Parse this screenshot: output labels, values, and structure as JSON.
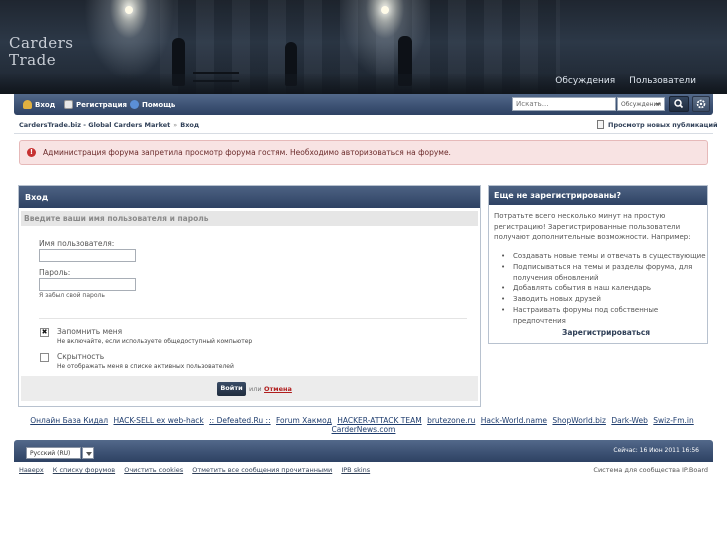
{
  "header": {
    "logo_line1": "Carders",
    "logo_line2": "Trade",
    "nav": [
      "Обсуждения",
      "Пользователи"
    ]
  },
  "toolbar": {
    "login": "Вход",
    "register": "Регистрация",
    "help": "Помощь",
    "search_placeholder": "Искать...",
    "search_scope": "Обсуждения"
  },
  "breadcrumb": {
    "site": "CardersTrade.biz - Global Carders Market",
    "current": "Вход",
    "new_posts": "Просмотр новых публикаций"
  },
  "error": {
    "icon": "!",
    "text": "Администрация форума запретила просмотр форума гостям. Необходимо авторизоваться на форуме."
  },
  "login": {
    "title": "Вход",
    "subtitle": "Введите ваши имя пользователя и пароль",
    "username_label": "Имя пользователя:",
    "password_label": "Пароль:",
    "forgot": "Я забыл свой пароль",
    "remember_label": "Запомнить меня",
    "remember_desc": "Не включайте, если используете общедоступный компьютер",
    "remember_mark": "✖",
    "hidden_label": "Скрытность",
    "hidden_desc": "Не отображать меня в списке активных пользователей",
    "submit": "Войти",
    "or": "или",
    "cancel": "Отмена"
  },
  "register": {
    "title": "Еще не зарегистрированы?",
    "intro": "Потратьте всего несколько минут на простую регистрацию! Зарегистрированные пользователи получают дополнительные возможности. Например:",
    "items": [
      "Создавать новые темы и отвечать в существующие",
      "Подписываться на темы и разделы форума, для получения обновлений",
      "Добавлять события в наш календарь",
      "Заводить новых друзей",
      "Настраивать форумы под собственные предпочтения"
    ],
    "link": "Зарегистрироваться"
  },
  "partner_links": [
    "Онлайн База Кидал",
    "HACK-SELL ex web-hack",
    ":: Defeated.Ru ::",
    "Forum Хакмод",
    "HACKER-ATTACK TEAM",
    "brutezone.ru",
    "Hack-World.name",
    "ShopWorld.biz",
    "Dark-Web",
    "Swiz-Fm.in",
    "CarderNews.com"
  ],
  "footer": {
    "language": "Русский (RU)",
    "time": "Сейчас: 16 Июн 2011 16:56",
    "links": [
      "Наверх",
      "К списку форумов",
      "Очистить cookies",
      "Отметить все сообщения прочитанными",
      "IPB skins"
    ],
    "powered": "Система для сообщества IP.Board"
  },
  "colors": {
    "toolbar": "#3d5274",
    "error_bg": "#f8e3e3",
    "error_icon": "#c73232",
    "link": "#1f3d6e",
    "cancel": "#b01e1e"
  }
}
